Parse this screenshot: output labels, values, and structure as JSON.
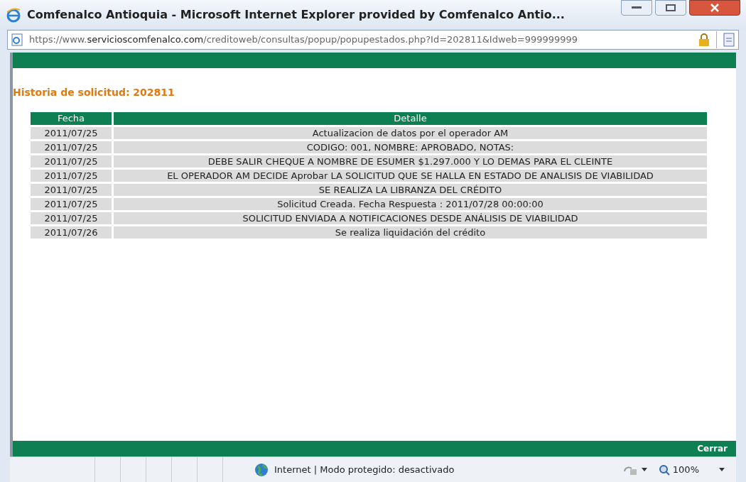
{
  "window": {
    "title": "Comfenalco Antioquia - Microsoft Internet Explorer provided by Comfenalco Antio..."
  },
  "address_bar": {
    "url": "https://www.**servicioscomfenalco.com**/creditoweb/consultas/popup/popupestados.php?Id=202811&Idweb=999999999"
  },
  "heading": "Historia de solicitud: 202811",
  "table": {
    "columns": [
      "Fecha",
      "Detalle"
    ],
    "rows": [
      [
        "2011/07/25",
        "Actualizacion de datos por el operador AM"
      ],
      [
        "2011/07/25",
        "CODIGO: 001, NOMBRE: APROBADO, NOTAS:"
      ],
      [
        "2011/07/25",
        "DEBE SALIR CHEQUE A NOMBRE DE ESUMER $1.297.000 Y LO DEMAS PARA EL CLEINTE"
      ],
      [
        "2011/07/25",
        "EL OPERADOR AM DECIDE Aprobar LA SOLICITUD QUE SE HALLA EN ESTADO DE ANALISIS DE VIABILIDAD"
      ],
      [
        "2011/07/25",
        "SE REALIZA LA LIBRANZA DEL CRÉDITO"
      ],
      [
        "2011/07/25",
        "Solicitud Creada. Fecha Respuesta : 2011/07/28 00:00:00"
      ],
      [
        "2011/07/25",
        "SOLICITUD ENVIADA A NOTIFICACIONES DESDE ANÁLISIS DE VIABILIDAD"
      ],
      [
        "2011/07/26",
        "Se realiza liquidación del crédito"
      ]
    ]
  },
  "footer": {
    "close_link": "Cerrar"
  },
  "status_bar": {
    "zone": "Internet | Modo protegido: desactivado",
    "zoom": "100%"
  }
}
